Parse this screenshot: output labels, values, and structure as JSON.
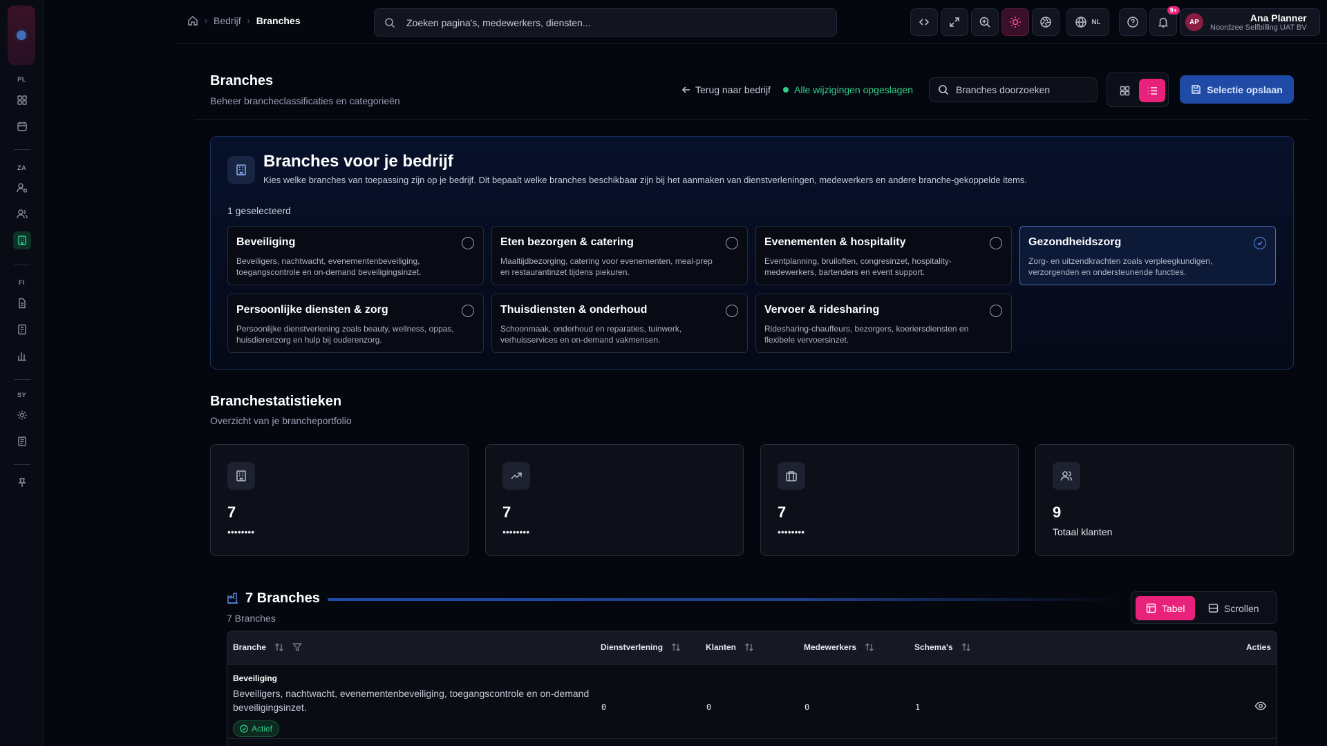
{
  "sidebar": {
    "sections": [
      "PL",
      "ZA",
      "FI",
      "SY"
    ],
    "items": [
      {
        "icon": "dashboard-icon"
      },
      {
        "icon": "calendar-icon"
      },
      {
        "icon": "user-cog-icon"
      },
      {
        "icon": "users-icon"
      },
      {
        "icon": "building-icon",
        "active": true
      },
      {
        "icon": "file-icon"
      },
      {
        "icon": "invoice-icon"
      },
      {
        "icon": "bar-chart-icon"
      },
      {
        "icon": "gear-icon"
      },
      {
        "icon": "log-icon"
      },
      {
        "icon": "pin-icon"
      }
    ]
  },
  "topbar": {
    "breadcrumb": [
      "Bedrijf",
      "Branches"
    ],
    "search_placeholder": "Zoeken pagina's, medewerkers, diensten...",
    "notifications_badge": "9+",
    "language": "NL",
    "user": {
      "initials": "AP",
      "name": "Ana Planner",
      "org": "Noordzee Selfbilling UAT BV"
    }
  },
  "header": {
    "title": "Branches",
    "subtitle": "Beheer brancheclassificaties en categorieën",
    "back_label": "Terug naar bedrijf",
    "saved_status": "Alle wijzigingen opgeslagen",
    "search_placeholder": "Branches doorzoeken",
    "save_selection_label": "Selectie opslaan"
  },
  "selection": {
    "title": "Branches voor je bedrijf",
    "description": "Kies welke branches van toepassing zijn op je bedrijf. Dit bepaalt welke branches beschikbaar zijn bij het aanmaken van dienstverleningen, medewerkers en andere branche-gekoppelde items.",
    "selected_count": "1 geselecteerd",
    "cards": [
      {
        "title": "Beveiliging",
        "description": "Beveiligers, nachtwacht, evenementenbeveiliging, toegangscontrole en on-demand beveiligingsinzet.",
        "selected": false
      },
      {
        "title": "Eten bezorgen & catering",
        "description": "Maaltijdbezorging, catering voor evenementen, meal-prep en restaurantinzet tijdens piekuren.",
        "selected": false
      },
      {
        "title": "Evenementen & hospitality",
        "description": "Eventplanning, bruiloften, congresinzet, hospitality-medewerkers, bartenders en event support.",
        "selected": false
      },
      {
        "title": "Gezondheidszorg",
        "description": "Zorg- en uitzendkrachten zoals verpleegkundigen, verzorgenden en ondersteunende functies.",
        "selected": true
      },
      {
        "title": "Persoonlijke diensten & zorg",
        "description": "Persoonlijke dienstverlening zoals beauty, wellness, oppas, huisdierenzorg en hulp bij ouderenzorg.",
        "selected": false
      },
      {
        "title": "Thuisdiensten & onderhoud",
        "description": "Schoonmaak, onderhoud en reparaties, tuinwerk, verhuisservices en on-demand vakmensen.",
        "selected": false
      },
      {
        "title": "Vervoer & ridesharing",
        "description": "Ridesharing-chauffeurs, bezorgers, koeriersdiensten en flexibele vervoersinzet.",
        "selected": false
      }
    ]
  },
  "stats": {
    "title": "Branchestatistieken",
    "subtitle": "Overzicht van je brancheportfolio",
    "cards": [
      {
        "icon": "building-icon",
        "value": "7",
        "label": "••••••••"
      },
      {
        "icon": "trending-up-icon",
        "value": "7",
        "label": "••••••••"
      },
      {
        "icon": "briefcase-icon",
        "value": "7",
        "label": "••••••••"
      },
      {
        "icon": "users-icon",
        "value": "9",
        "label": "Totaal klanten"
      }
    ]
  },
  "table": {
    "title": "7 Branches",
    "subtitle": "7 Branches",
    "view_tabs": [
      "Tabel",
      "Scrollen"
    ],
    "active_tab": "Tabel",
    "columns": [
      "Branche",
      "Dienstverlening",
      "Klanten",
      "Medewerkers",
      "Schema's",
      "Acties"
    ],
    "rows": [
      {
        "name": "Beveiliging",
        "description": "Beveiligers, nachtwacht, evenementenbeveiliging, toegangscontrole en on-demand beveiligingsinzet.",
        "status": "Actief",
        "dienstverlening": "0",
        "klanten": "0",
        "medewerkers": "0",
        "schemas": "1"
      }
    ]
  },
  "colors": {
    "accent_pink": "#e8217a",
    "accent_blue": "#1f4ba6",
    "success_green": "#2fd08a"
  }
}
